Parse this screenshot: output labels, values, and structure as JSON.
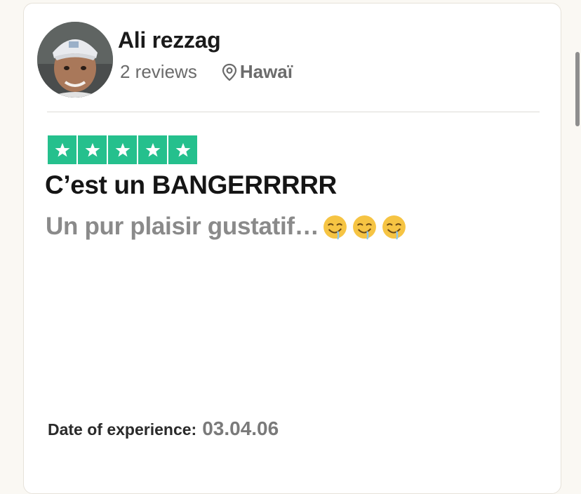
{
  "reviewer": {
    "name": "Ali rezzag",
    "reviews_count": "2 reviews",
    "location": "Hawaï"
  },
  "rating": {
    "stars": 5,
    "max_stars": 5,
    "star_color": "#00b67a"
  },
  "review": {
    "title": "C’est un BANGERRRRR",
    "body": "Un pur plaisir gustatif…",
    "emojis": [
      "drooling-face-icon",
      "drooling-face-icon",
      "drooling-face-icon"
    ]
  },
  "experience": {
    "label": "Date of experience:",
    "date": "03.04.06"
  }
}
